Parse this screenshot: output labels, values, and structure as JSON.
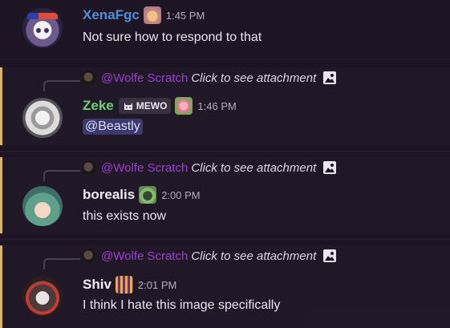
{
  "colors": {
    "xena": "#4d8fe0",
    "zeke": "#6fd07a",
    "white": "#f1edf4",
    "reply_name": "#9b3fd0",
    "highlight": "#d9b46a"
  },
  "messages": [
    {
      "username": "XenaFgc",
      "time": "1:45 PM",
      "text": "Not sure how to respond to that"
    },
    {
      "reply": {
        "name": "@Wolfe Scratch",
        "text": "Click to see attachment"
      },
      "username": "Zeke",
      "tag": "MEWO",
      "time": "1:46 PM",
      "text": "@Beastly"
    },
    {
      "reply": {
        "name": "@Wolfe Scratch",
        "text": "Click to see attachment"
      },
      "username": "borealis",
      "time": "2:00 PM",
      "text": "this exists now"
    },
    {
      "reply": {
        "name": "@Wolfe Scratch",
        "text": "Click to see attachment"
      },
      "username": "Shiv",
      "time": "2:01 PM",
      "text": "I think I hate this image specifically"
    }
  ],
  "icons": {
    "image": "image-icon",
    "avatar": "avatar",
    "badge": "role-badge-icon",
    "tag": "cat-tag-icon"
  }
}
